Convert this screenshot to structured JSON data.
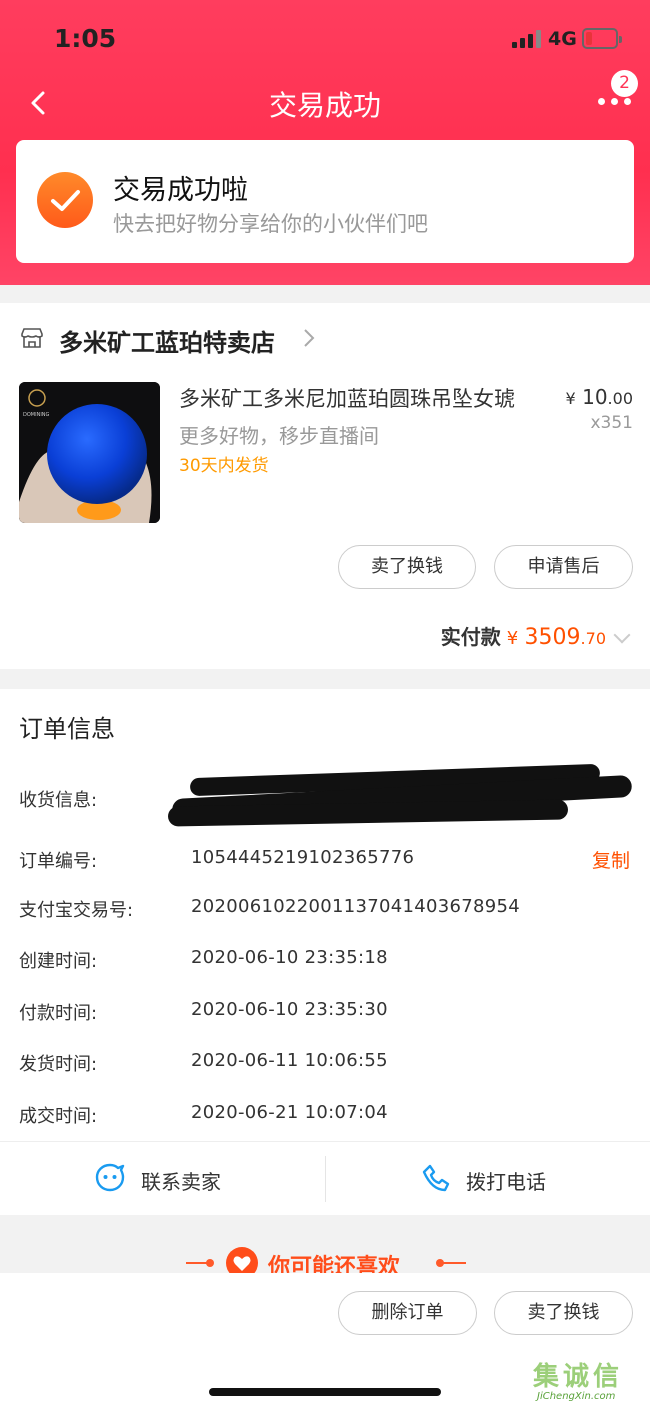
{
  "status_bar": {
    "time": "1:05",
    "network": "4G"
  },
  "nav": {
    "title": "交易成功",
    "badge": "2"
  },
  "success": {
    "title": "交易成功啦",
    "subtitle": "快去把好物分享给你的小伙伴们吧"
  },
  "shop": {
    "name": "多米矿工蓝珀特卖店"
  },
  "product": {
    "title": "多米矿工多米尼加蓝珀圆珠吊坠女琥",
    "subtitle": "更多好物，移步直播间",
    "shipping": "30天内发货",
    "price_symbol": "¥",
    "price_int": "10",
    "price_dec": ".00",
    "quantity": "x351",
    "logo_text": "DOMINING"
  },
  "actions": {
    "sell_label": "卖了换钱",
    "after_sale_label": "申请售后"
  },
  "payment": {
    "label": "实付款",
    "symbol": "¥",
    "amount_int": "3509",
    "amount_dec": ".70"
  },
  "order": {
    "title": "订单信息",
    "rows": [
      {
        "label": "收货信息:",
        "value": ""
      },
      {
        "label": "订单编号:",
        "value": "1054445219102365776"
      },
      {
        "label": "支付宝交易号:",
        "value": "2020061022001137041403678954"
      },
      {
        "label": "创建时间:",
        "value": "2020-06-10 23:35:18"
      },
      {
        "label": "付款时间:",
        "value": "2020-06-10 23:35:30"
      },
      {
        "label": "发货时间:",
        "value": "2020-06-11 10:06:55"
      },
      {
        "label": "成交时间:",
        "value": "2020-06-21 10:07:04"
      }
    ],
    "copy_label": "复制"
  },
  "contact": {
    "seller_label": "联系卖家",
    "phone_label": "拨打电话"
  },
  "recommend": {
    "title": "你可能还喜欢"
  },
  "bottom": {
    "delete_label": "删除订单",
    "sell_label": "卖了换钱"
  },
  "watermark": {
    "big": "集诚信",
    "small": "JiChengXin.com"
  },
  "colors": {
    "header": "#ff3355",
    "accent": "#ff5000",
    "shipping": "#ff9a00",
    "icon_blue": "#1a9bf0"
  }
}
